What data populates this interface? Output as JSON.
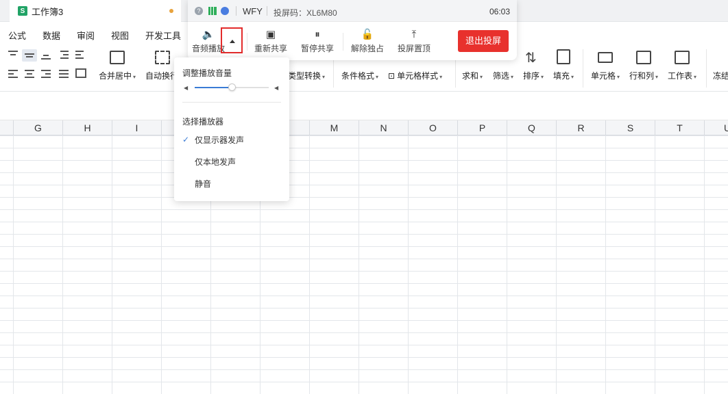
{
  "tab": {
    "icon": "S",
    "title": "工作簿3"
  },
  "menu": [
    "公式",
    "数据",
    "审阅",
    "视图",
    "开发工具"
  ],
  "ribbon": {
    "merge_center": "合并居中",
    "auto_wrap": "自动换行",
    "type_convert": "类型转换",
    "cond_format": "条件格式",
    "cell_style": "单元格样式",
    "sum": "求和",
    "filter": "筛选",
    "sort": "排序",
    "fill": "填充",
    "cell": "单元格",
    "row_col": "行和列",
    "worksheet": "工作表",
    "freeze": "冻结"
  },
  "columns": [
    "G",
    "H",
    "I",
    "M",
    "N",
    "O",
    "P",
    "Q",
    "R",
    "S",
    "T",
    "U"
  ],
  "share_bar": {
    "user": "WFY",
    "code_label": "投屏码：XL6M80",
    "time": "06:03",
    "audio_play": "音频播放",
    "reshare": "重新共享",
    "pause_share": "暂停共享",
    "unlock_exclusive": "解除独占",
    "pin_top": "投屏置顶",
    "exit": "退出投屏"
  },
  "audio_panel": {
    "volume_title": "调整播放音量",
    "volume_level": 0.5,
    "player_title": "选择播放器",
    "options": [
      "仅显示器发声",
      "仅本地发声",
      "静音"
    ],
    "selected_option": "仅显示器发声"
  },
  "colors": {
    "accent": "#3a7bd5",
    "exit": "#e8312d",
    "highlight": "#e32b2b",
    "excel_green": "#21a366"
  }
}
